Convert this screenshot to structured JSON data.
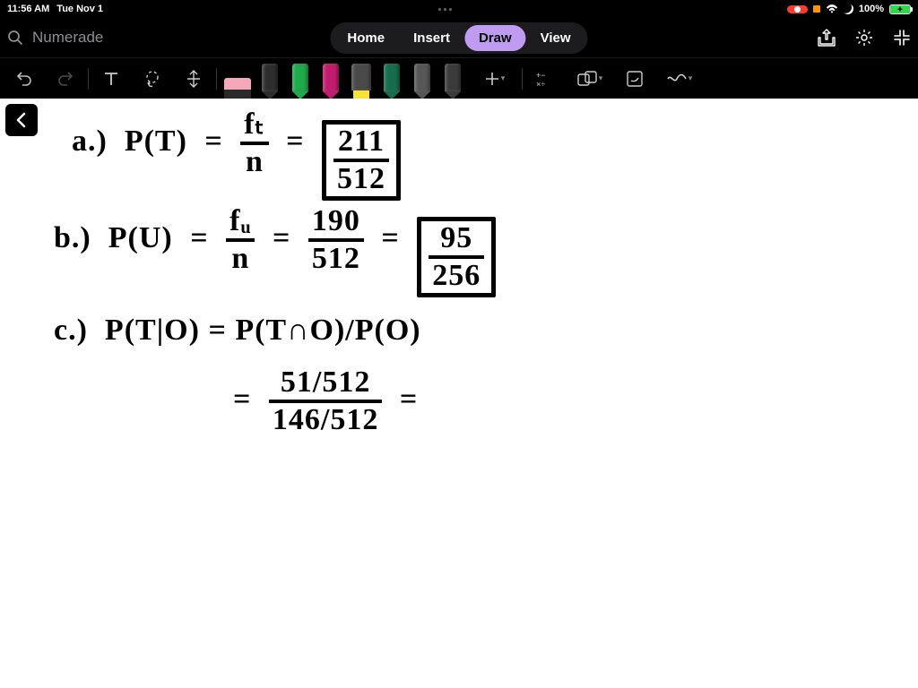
{
  "status": {
    "time": "11:56 AM",
    "date": "Tue Nov 1",
    "battery_pct": "100%"
  },
  "title_row": {
    "search_placeholder": "Numerade",
    "tabs": {
      "home": "Home",
      "insert": "Insert",
      "draw": "Draw",
      "view": "View"
    }
  },
  "toolbar": {
    "pen_colors": {
      "eraser": "#f5a8b8",
      "black": "#2e2e2e",
      "green": "#1faa4b",
      "magenta": "#c31c6e",
      "yellow_hi": "#f7e23b",
      "teal": "#166e4f",
      "gray": "#575757",
      "slate": "#3b3b3b"
    }
  },
  "handwriting": {
    "a": {
      "label": "a.)",
      "lhs": "P(T)",
      "frac1_num": "fₜ",
      "frac1_den": "n",
      "ans_num": "211",
      "ans_den": "512"
    },
    "b": {
      "label": "b.)",
      "lhs": "P(U)",
      "frac1_num": "fᵤ",
      "frac1_den": "n",
      "mid_num": "190",
      "mid_den": "512",
      "ans_num": "95",
      "ans_den": "256"
    },
    "c": {
      "label": "c.)",
      "line1": "P(T|O) = P(T∩O)/P(O)",
      "frac_num": "51/512",
      "frac_den": "146/512"
    }
  }
}
